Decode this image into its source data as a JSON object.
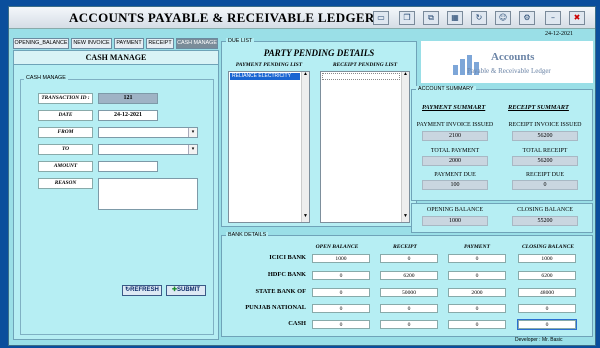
{
  "window": {
    "title": "ACCOUNTS PAYABLE & RECEIVABLE LEDGER",
    "date": "24-12-2021",
    "footer": "Developer : Mr. Basic"
  },
  "tabs": [
    {
      "label": "OPENING_BALANCE"
    },
    {
      "label": "NEW INVOICE"
    },
    {
      "label": "PAYMENT"
    },
    {
      "label": "RECEIPT"
    },
    {
      "label": "CASH MANAGE"
    }
  ],
  "cash_manage": {
    "header": "CASH MANAGE",
    "group_label": "CASH MANAGE",
    "transaction_id_label": "TRANSACTION ID :",
    "transaction_id": "121",
    "date_label": "DATE",
    "date": "24-12-2021",
    "from_label": "FROM",
    "to_label": "TO",
    "amount_label": "AMOUNT",
    "reason_label": "REASON",
    "refresh_label": "REFRESH",
    "submit_label": "SUBMIT"
  },
  "due_list": {
    "group_label": "DUE LIST",
    "title": "PARTY PENDING DETAILS",
    "payment_header": "PAYMENT PENDING LIST",
    "receipt_header": "RECEIPT PENDING LIST",
    "payment_items": [
      "RELIANCE ELECTRICITY"
    ]
  },
  "logo": {
    "line1": "Accounts",
    "line2": "Payable & Receivable Ledger"
  },
  "account_summary": {
    "group_label": "ACCOUNT SUMMARY",
    "payment_header": "PAYMENT SUMMART",
    "receipt_header": "RECEIPT SUMMART",
    "payment_invoice_label": "PAYMENT INVOICE ISSUED",
    "payment_invoice_value": "2100",
    "receipt_invoice_label": "RECEIPT INVOICE ISSUED",
    "receipt_invoice_value": "56200",
    "total_payment_label": "TOTAL PAYMENT",
    "total_payment_value": "2000",
    "total_receipt_label": "TOTAL RECEIPT",
    "total_receipt_value": "56200",
    "payment_due_label": "PAYMENT DUE",
    "payment_due_value": "100",
    "receipt_due_label": "RECEIPT DUE",
    "receipt_due_value": "0"
  },
  "balances": {
    "opening_label": "OPENING BALANCE",
    "opening_value": "1000",
    "closing_label": "CLOSING BALANCE",
    "closing_value": "55200"
  },
  "bank_details": {
    "group_label": "BANK DETAILS",
    "columns": [
      "OPEN BALANCE",
      "RECEIPT",
      "PAYMENT",
      "CLOSING BALANCE"
    ],
    "rows": [
      {
        "name": "ICICI BANK",
        "cells": [
          "1000",
          "0",
          "0",
          "1000"
        ]
      },
      {
        "name": "HDFC BANK",
        "cells": [
          "0",
          "6200",
          "0",
          "6200"
        ]
      },
      {
        "name": "STATE BANK OF",
        "cells": [
          "0",
          "50000",
          "2000",
          "48000"
        ]
      },
      {
        "name": "PUNJAB NATIONAL",
        "cells": [
          "0",
          "0",
          "0",
          "0"
        ]
      },
      {
        "name": "CASH",
        "cells": [
          "0",
          "0",
          "0",
          "0"
        ]
      }
    ]
  }
}
